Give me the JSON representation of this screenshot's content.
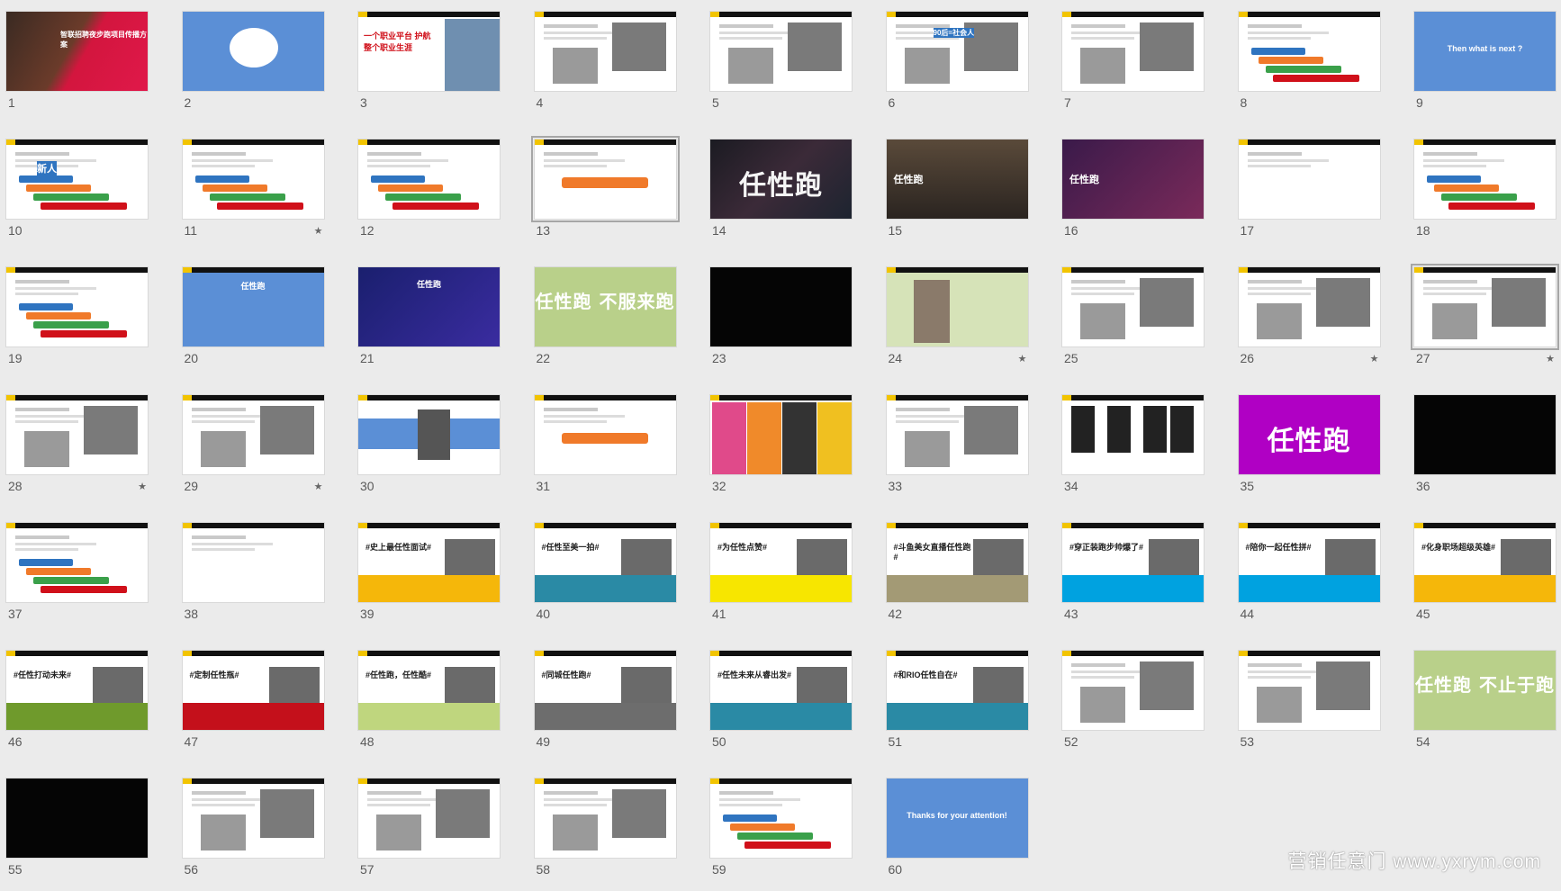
{
  "watermark": "营销任意门 www.yxrym.com",
  "slides": [
    {
      "n": "1",
      "style": "photo-red",
      "text": "智联招聘夜步跑项目传播方案"
    },
    {
      "n": "2",
      "style": "blue",
      "text": ""
    },
    {
      "n": "3",
      "style": "white-red",
      "text": "一个职业平台 护航 整个职业生涯"
    },
    {
      "n": "4",
      "style": "white-photo",
      "text": ""
    },
    {
      "n": "5",
      "style": "white-photo",
      "text": ""
    },
    {
      "n": "6",
      "style": "white-photo",
      "text": "90后=社会人"
    },
    {
      "n": "7",
      "style": "white-photo",
      "text": ""
    },
    {
      "n": "8",
      "style": "white-diagram",
      "text": ""
    },
    {
      "n": "9",
      "style": "blue",
      "text": "Then what is next ?"
    },
    {
      "n": "10",
      "style": "white-diagram",
      "text": "新人"
    },
    {
      "n": "11",
      "style": "white-diagram",
      "text": "",
      "star": true
    },
    {
      "n": "12",
      "style": "white-diagram",
      "text": ""
    },
    {
      "n": "13",
      "style": "white-orange",
      "text": "",
      "sel": true
    },
    {
      "n": "14",
      "style": "dark-red",
      "text": "任性跑"
    },
    {
      "n": "15",
      "style": "dark-photo",
      "text": "任性跑"
    },
    {
      "n": "16",
      "style": "purple-photo",
      "text": "任性跑"
    },
    {
      "n": "17",
      "style": "white",
      "text": ""
    },
    {
      "n": "18",
      "style": "white-diagram",
      "text": ""
    },
    {
      "n": "19",
      "style": "white-diagram",
      "text": ""
    },
    {
      "n": "20",
      "style": "blue-grid",
      "text": "任性跑"
    },
    {
      "n": "21",
      "style": "navy",
      "text": "任性跑"
    },
    {
      "n": "22",
      "style": "green",
      "text": "任性跑 不服来跑"
    },
    {
      "n": "23",
      "style": "black",
      "text": ""
    },
    {
      "n": "24",
      "style": "green-photo",
      "text": "",
      "star": true
    },
    {
      "n": "25",
      "style": "white-photo",
      "text": ""
    },
    {
      "n": "26",
      "style": "white-photo",
      "text": "",
      "star": true
    },
    {
      "n": "27",
      "style": "white-photo",
      "text": "",
      "star": true,
      "sel": true
    },
    {
      "n": "28",
      "style": "white-photo",
      "text": "",
      "star": true
    },
    {
      "n": "29",
      "style": "white-photo",
      "text": "",
      "star": true
    },
    {
      "n": "30",
      "style": "blue-band",
      "text": ""
    },
    {
      "n": "31",
      "style": "white-orange",
      "text": ""
    },
    {
      "n": "32",
      "style": "colorful",
      "text": ""
    },
    {
      "n": "33",
      "style": "white-photo",
      "text": ""
    },
    {
      "n": "34",
      "style": "white-dark",
      "text": ""
    },
    {
      "n": "35",
      "style": "magenta",
      "text": "任性跑"
    },
    {
      "n": "36",
      "style": "black",
      "text": ""
    },
    {
      "n": "37",
      "style": "white-diagram",
      "text": ""
    },
    {
      "n": "38",
      "style": "white",
      "text": ""
    },
    {
      "n": "39",
      "style": "yellow-band",
      "text": "#史上最任性面试#"
    },
    {
      "n": "40",
      "style": "teal-band",
      "text": "#任性至美一拍#"
    },
    {
      "n": "41",
      "style": "yellow-band2",
      "text": "#为任性点赞#"
    },
    {
      "n": "42",
      "style": "tan-band",
      "text": "#斗鱼美女直播任性跑#"
    },
    {
      "n": "43",
      "style": "sky-band",
      "text": "#穿正装跑步帅爆了#"
    },
    {
      "n": "44",
      "style": "sky-band",
      "text": "#陪你一起任性拼#"
    },
    {
      "n": "45",
      "style": "yellow-band",
      "text": "#化身职场超级英雄#"
    },
    {
      "n": "46",
      "style": "olive-band",
      "text": "#任性打动未来#"
    },
    {
      "n": "47",
      "style": "red-band",
      "text": "#定制任性瓶#"
    },
    {
      "n": "48",
      "style": "lime-band",
      "text": "#任性跑，任性酷#"
    },
    {
      "n": "49",
      "style": "gray-band",
      "text": "#同城任性跑#"
    },
    {
      "n": "50",
      "style": "teal-band",
      "text": "#任性未来从睿出发#"
    },
    {
      "n": "51",
      "style": "teal-band",
      "text": "#和RIO任性自在#"
    },
    {
      "n": "52",
      "style": "white-photo",
      "text": ""
    },
    {
      "n": "53",
      "style": "white-photo",
      "text": ""
    },
    {
      "n": "54",
      "style": "green",
      "text": "任性跑 不止于跑"
    },
    {
      "n": "55",
      "style": "black",
      "text": ""
    },
    {
      "n": "56",
      "style": "white-photo",
      "text": ""
    },
    {
      "n": "57",
      "style": "white-photo",
      "text": ""
    },
    {
      "n": "58",
      "style": "white-photo",
      "text": ""
    },
    {
      "n": "59",
      "style": "white-diagram",
      "text": ""
    },
    {
      "n": "60",
      "style": "blue",
      "text": "Thanks for your attention!"
    }
  ],
  "colors": {
    "background": "#ebebeb",
    "slide_blue": "#5b8fd6",
    "magenta": "#b000c4",
    "green": "#b9d08a"
  }
}
